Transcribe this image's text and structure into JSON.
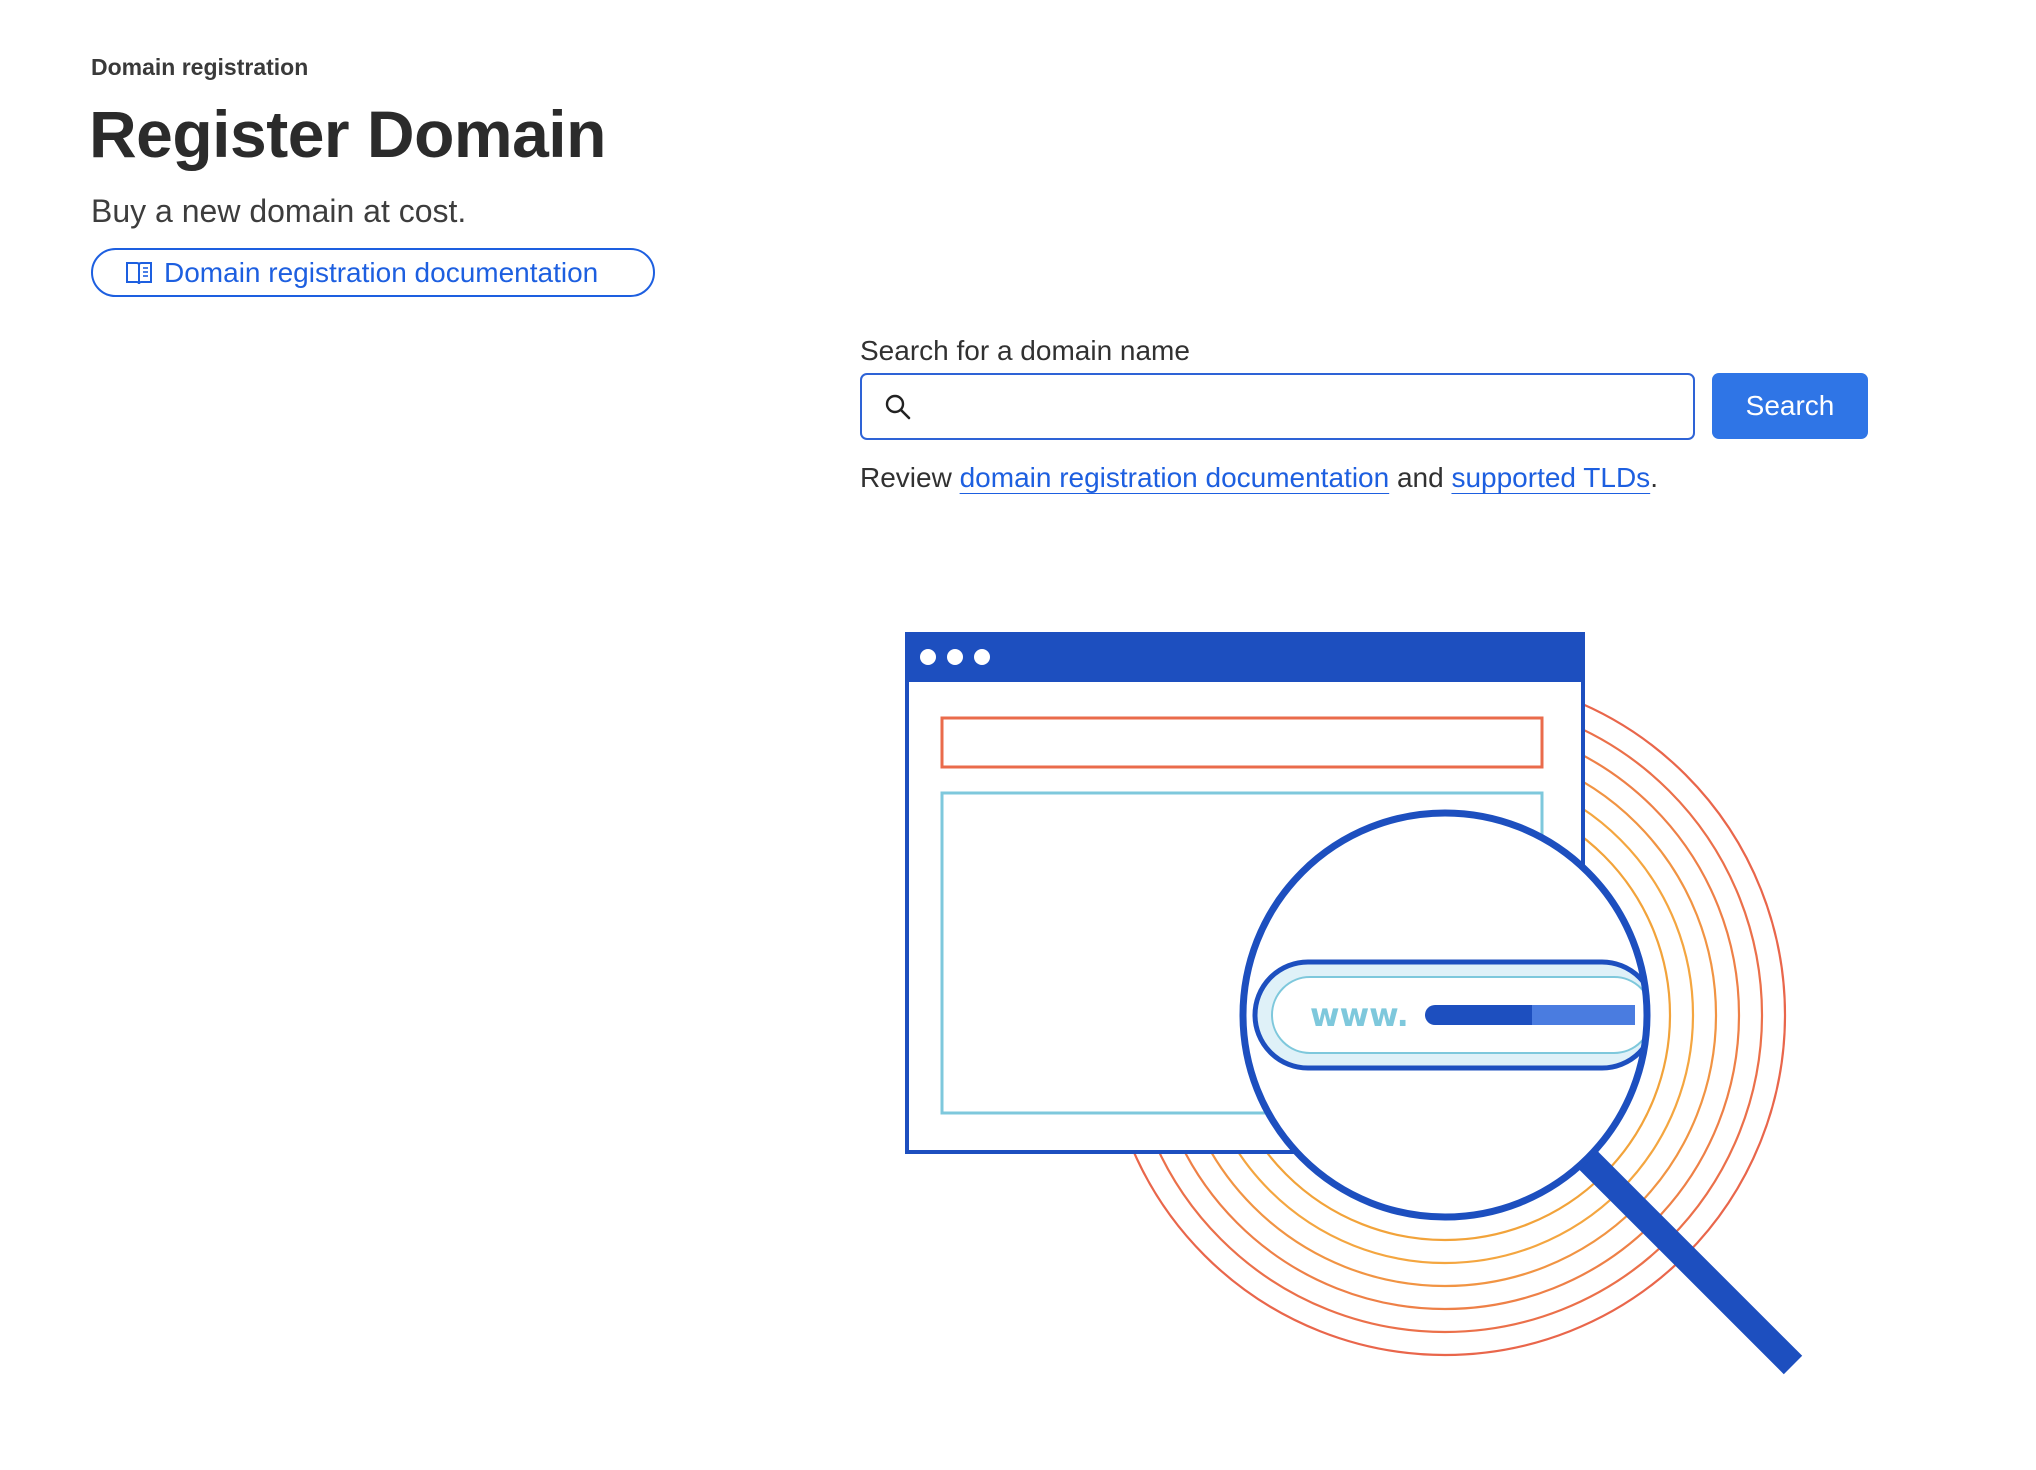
{
  "header": {
    "breadcrumb": "Domain registration",
    "title": "Register Domain",
    "subtitle": "Buy a new domain at cost.",
    "doc_link_label": "Domain registration documentation",
    "doc_link_icon": "book-icon"
  },
  "search": {
    "label": "Search for a domain name",
    "value": "",
    "placeholder": "",
    "icon": "search-icon",
    "button_label": "Search"
  },
  "review": {
    "prefix": "Review ",
    "link1": "domain registration documentation",
    "middle": " and ",
    "link2": "supported TLDs",
    "suffix": "."
  },
  "illustration": {
    "url_text": "www.",
    "icon": "magnifying-glass-browser-illustration"
  },
  "colors": {
    "accent": "#1d5fe0",
    "button": "#2f75e6",
    "browser_bar": "#1d4fbf",
    "orange": "#ea6b4b",
    "amber": "#f2a33a",
    "teal": "#7ec8dc"
  }
}
